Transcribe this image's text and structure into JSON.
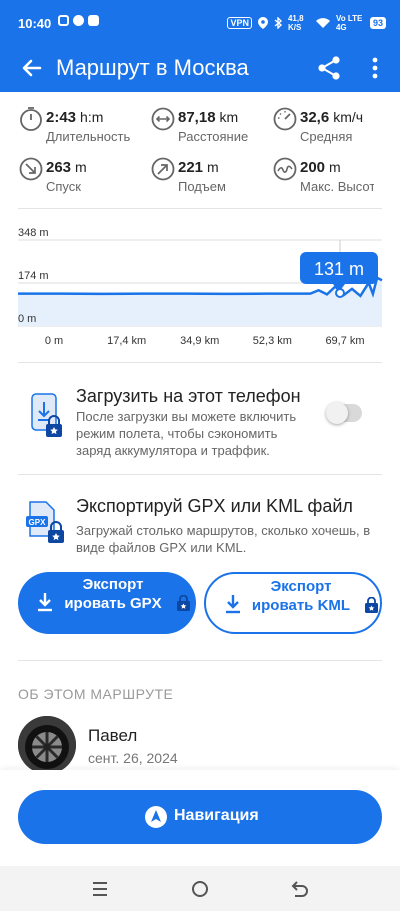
{
  "status_bar": {
    "time": "10:40",
    "vpn": "VPN",
    "net_speed": "41,8 K/S",
    "network": "Vo LTE 4G",
    "battery": "93"
  },
  "app_bar": {
    "title": "Маршрут в Москва",
    "icons": [
      "back-arrow-icon",
      "share-icon",
      "more-vert-icon"
    ]
  },
  "stats": [
    {
      "icon": "stopwatch-icon",
      "value": "2:43",
      "unit": "h:m",
      "label": "Длительность"
    },
    {
      "icon": "distance-icon",
      "value": "87,18",
      "unit": "km",
      "label": "Расстояние"
    },
    {
      "icon": "speedometer-icon",
      "value": "32,6",
      "unit": "km/ч",
      "label": "Средняя"
    },
    {
      "icon": "descent-icon",
      "value": "263",
      "unit": "m",
      "label": "Спуск"
    },
    {
      "icon": "ascent-icon",
      "value": "221",
      "unit": "m",
      "label": "Подъем"
    },
    {
      "icon": "max-altitude-icon",
      "value": "200",
      "unit": "m",
      "label": "Макс. Высота"
    }
  ],
  "chart_data": {
    "type": "area",
    "y_ticks": [
      "348 m",
      "174 m",
      "0 m"
    ],
    "x_ticks": [
      "0 m",
      "17,4 km",
      "34,9 km",
      "52,3 km",
      "69,7 km"
    ],
    "ylim": [
      0,
      348
    ],
    "xlim": [
      0,
      87.18
    ],
    "tooltip": "131 m",
    "series": [
      {
        "x": [
          0,
          10,
          20,
          30,
          40,
          50,
          60,
          65,
          70,
          72,
          74,
          76,
          78,
          80,
          82,
          84,
          85,
          86,
          87.18
        ],
        "y": [
          131,
          131,
          130,
          131,
          131,
          130,
          131,
          131,
          131,
          145,
          128,
          160,
          125,
          150,
          122,
          175,
          130,
          195,
          185
        ]
      }
    ],
    "colors": {
      "line": "#1a73e8",
      "fill": "#e6f0fc"
    }
  },
  "offline": {
    "icon": "phone-download-lock-icon",
    "title": "Загрузить на этот телефон",
    "description": "После загрузки вы можете включить режим полета, чтобы сэкономить заряд аккумулятора и траффик.",
    "toggle_on": false
  },
  "export": {
    "icon": "gpx-file-lock-icon",
    "title": "Экспортируй GPX или KML файл",
    "description": "Загружай столько маршрутов, сколько хочешь, в виде файлов GPX или KML.",
    "gpx_button": "Экспорт ировать GPX",
    "kml_button": "Экспорт ировать KML"
  },
  "about": {
    "heading": "ОБ ЭТОМ МАРШРУТЕ",
    "author_name": "Павел",
    "date": "сент. 26, 2024"
  },
  "navigation_button": "Навигация",
  "colors": {
    "primary": "#1a73e8",
    "secondary_text": "#666666",
    "divider": "#e4e4e4"
  }
}
